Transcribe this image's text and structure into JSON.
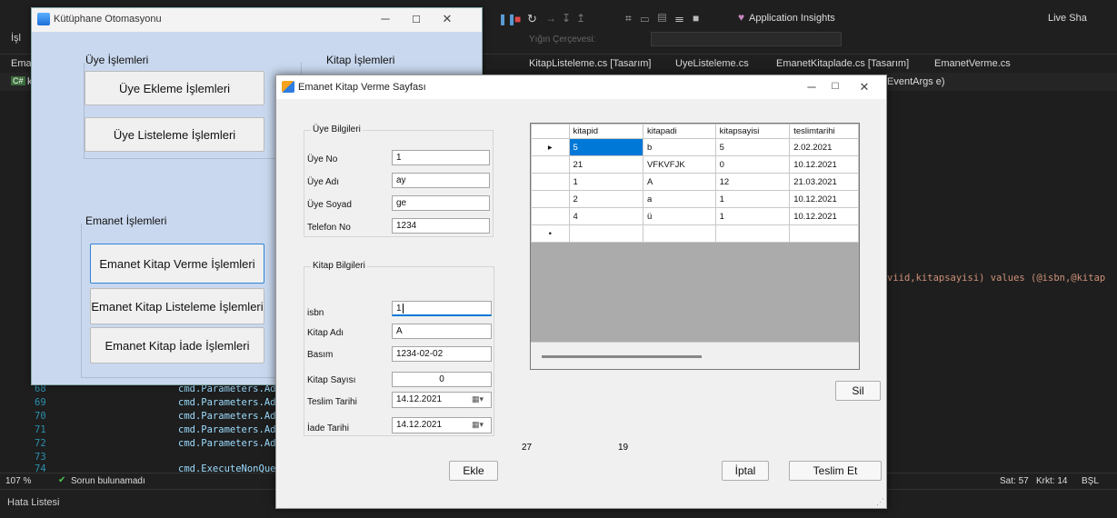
{
  "vs": {
    "toolbar_left": "İşl",
    "app_insights": "Application Insights",
    "live_share": "Live Sha",
    "stack_frame": "Yığın Çerçevesi:",
    "tabs": [
      "Ema",
      "KitapListeleme.cs [Tasarım]",
      "UyeListeleme.cs",
      "EmanetKitaplade.cs [Tasarım]",
      "EmanetVerme.cs"
    ],
    "nav_left": "k",
    "nav_right": "EventArgs e)",
    "code_right": "viid,kitapsayisi) values (@isbn,@kitap",
    "lines": [
      {
        "n": "68",
        "code": "cmd.Parameters.Ad"
      },
      {
        "n": "69",
        "code": "cmd.Parameters.Ad"
      },
      {
        "n": "70",
        "code": "cmd.Parameters.Ad"
      },
      {
        "n": "71",
        "code": "cmd.Parameters.Ad"
      },
      {
        "n": "72",
        "code": "cmd.Parameters.Ad"
      },
      {
        "n": "73",
        "code": ""
      },
      {
        "n": "74",
        "code": "cmd.ExecuteNonQuer"
      }
    ],
    "zoom": "107 %",
    "no_issues": "Sorun bulunamadı",
    "line_pos": "Sat: 57",
    "col_pos": "Krkt: 14",
    "mode": "BŞL",
    "error_list": "Hata Listesi",
    "accent": "#0078d7"
  },
  "main": {
    "title": "Kütüphane Otomasyonu",
    "uye_group": "Üye İşlemleri",
    "kitap_group": "Kitap İşlemleri",
    "emanet_group": "Emanet İşlemleri",
    "btn_uye_ekle": "Üye Ekleme İşlemleri",
    "btn_uye_listele": "Üye Listeleme İşlemleri",
    "btn_emanet_verme": "Emanet Kitap Verme İşlemleri",
    "btn_emanet_listele": "Emanet Kitap Listeleme İşlemleri",
    "btn_emanet_iade": "Emanet Kitap İade İşlemleri",
    "bg": "#c9d8ee"
  },
  "dialog": {
    "title": "Emanet Kitap Verme Sayfası",
    "uye_bilgileri": "Üye Bilgileri",
    "uye_no_label": "Üye No",
    "uye_no": "1",
    "uye_adi_label": "Üye Adı",
    "uye_adi": "ay",
    "uye_soyad_label": "Üye Soyad",
    "uye_soyad": "ge",
    "telefon_label": "Telefon No",
    "telefon": "1234",
    "kitap_bilgileri": "Kitap Bilgileri",
    "isbn_label": "isbn",
    "isbn": "1",
    "kitap_adi_label": "Kitap Adı",
    "kitap_adi": "A",
    "basim_label": "Basım",
    "basim": "1234-02-02",
    "kitap_sayisi_label": "Kitap  Sayısı",
    "kitap_sayisi": "0",
    "teslim_label": "Teslim Tarihi",
    "teslim": "14.12.2021",
    "iade_label": "İade Tarihi",
    "iade": "14.12.2021",
    "count1": "27",
    "count2": "19",
    "btn_ekle": "Ekle",
    "btn_iptal": "İptal",
    "btn_teslim": "Teslim Et",
    "btn_sil": "Sil",
    "grid": {
      "columns": [
        "kitapid",
        "kitapadi",
        "kitapsayisi",
        "teslimtarihi"
      ],
      "rows": [
        [
          "5",
          "b",
          "5",
          "2.02.2021"
        ],
        [
          "21",
          "VFKVFJK",
          "0",
          "10.12.2021"
        ],
        [
          "1",
          "A",
          "12",
          "21.03.2021"
        ],
        [
          "2",
          "a",
          "1",
          "10.12.2021"
        ],
        [
          "4",
          "ü",
          "1",
          "10.12.2021"
        ]
      ]
    }
  }
}
